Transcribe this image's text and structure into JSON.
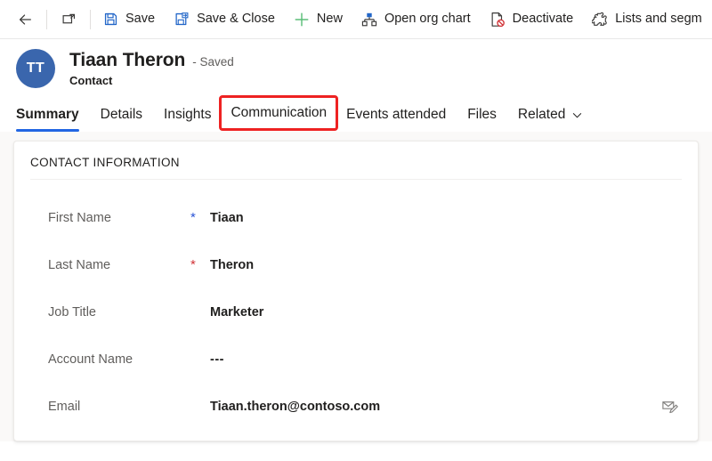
{
  "commandbar": {
    "buttons": [
      {
        "label": "",
        "icon": "back-arrow-icon",
        "icon_only": true
      },
      {
        "label": "",
        "icon": "popout-window-icon",
        "icon_only": true
      },
      {
        "label": "Save",
        "icon": "save-floppy-icon",
        "icon_only": false
      },
      {
        "label": "Save & Close",
        "icon": "save-close-icon",
        "icon_only": false
      },
      {
        "label": "New",
        "icon": "plus-icon",
        "icon_only": false
      },
      {
        "label": "Open org chart",
        "icon": "org-chart-icon",
        "icon_only": false
      },
      {
        "label": "Deactivate",
        "icon": "deactivate-icon",
        "icon_only": false
      },
      {
        "label": "Lists and segm",
        "icon": "lists-segments-icon",
        "icon_only": false
      }
    ]
  },
  "record": {
    "avatar_initials": "TT",
    "avatar_color": "#3A66AD",
    "title": "Tiaan Theron",
    "state": "- Saved",
    "subtitle": "Contact"
  },
  "tabs": {
    "items": [
      {
        "label": "Summary",
        "active": true,
        "highlighted": false,
        "has_chevron": false
      },
      {
        "label": "Details",
        "active": false,
        "highlighted": false,
        "has_chevron": false
      },
      {
        "label": "Insights",
        "active": false,
        "highlighted": false,
        "has_chevron": false
      },
      {
        "label": "Communication",
        "active": false,
        "highlighted": true,
        "has_chevron": false
      },
      {
        "label": "Events attended",
        "active": false,
        "highlighted": false,
        "has_chevron": false
      },
      {
        "label": "Files",
        "active": false,
        "highlighted": false,
        "has_chevron": false
      },
      {
        "label": "Related",
        "active": false,
        "highlighted": false,
        "has_chevron": true
      }
    ],
    "active_underline_color": "#2266E3",
    "highlight_color": "#EE2222"
  },
  "form": {
    "section_title": "CONTACT INFORMATION",
    "fields": [
      {
        "label": "First Name",
        "value": "Tiaan",
        "requirement": "recommended",
        "mark": "*",
        "action_icon": ""
      },
      {
        "label": "Last Name",
        "value": "Theron",
        "requirement": "required",
        "mark": "*",
        "action_icon": ""
      },
      {
        "label": "Job Title",
        "value": "Marketer",
        "requirement": "none",
        "mark": "",
        "action_icon": ""
      },
      {
        "label": "Account Name",
        "value": "---",
        "requirement": "none",
        "mark": "",
        "action_icon": ""
      },
      {
        "label": "Email",
        "value": "Tiaan.theron@contoso.com",
        "requirement": "none",
        "mark": "",
        "action_icon": "compose-email-icon"
      }
    ]
  },
  "colors": {
    "accent_blue": "#2266E3",
    "save_icon_blue": "#2266c8",
    "new_icon_green": "#5BBD79",
    "required_red": "#d13438",
    "recommended_blue": "#2a53d6",
    "canvas_gray": "#faf9f8"
  }
}
